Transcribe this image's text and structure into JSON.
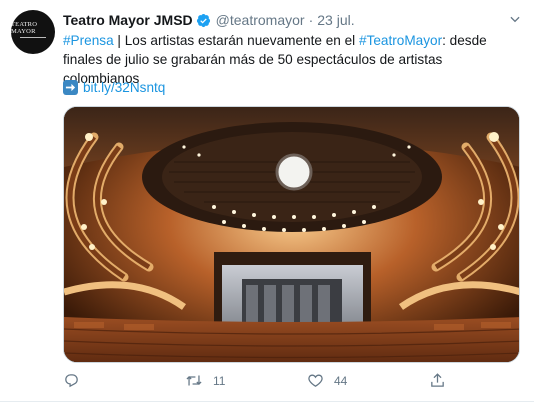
{
  "tweet": {
    "author_name": "Teatro Mayor JMSD",
    "handle": "@teatromayor",
    "separator": "·",
    "date": "23 jul.",
    "avatar_text": "TEATRO MAYOR",
    "text_hashtag1": "#Prensa",
    "text_part1": " | Los artistas estarán nuevamente en el ",
    "text_hashtag2": "#TeatroMayor",
    "text_part2": ": desde finales de julio se grabarán más de 50 espectáculos de artistas colombianos",
    "link": "bit.ly/32Nsntq",
    "media_alt": "Interior del Teatro Mayor con balcones iluminados y escenario",
    "retweets": "11",
    "likes": "44"
  },
  "icons": {
    "verified": "verified-badge-icon",
    "caret": "chevron-down-icon",
    "arrow": "right-arrow-emoji-icon",
    "reply": "reply-icon",
    "retweet": "retweet-icon",
    "like": "heart-icon",
    "share": "share-icon"
  },
  "colors": {
    "link": "#1b95e0",
    "verified": "#1da1f2",
    "muted": "#657786"
  }
}
